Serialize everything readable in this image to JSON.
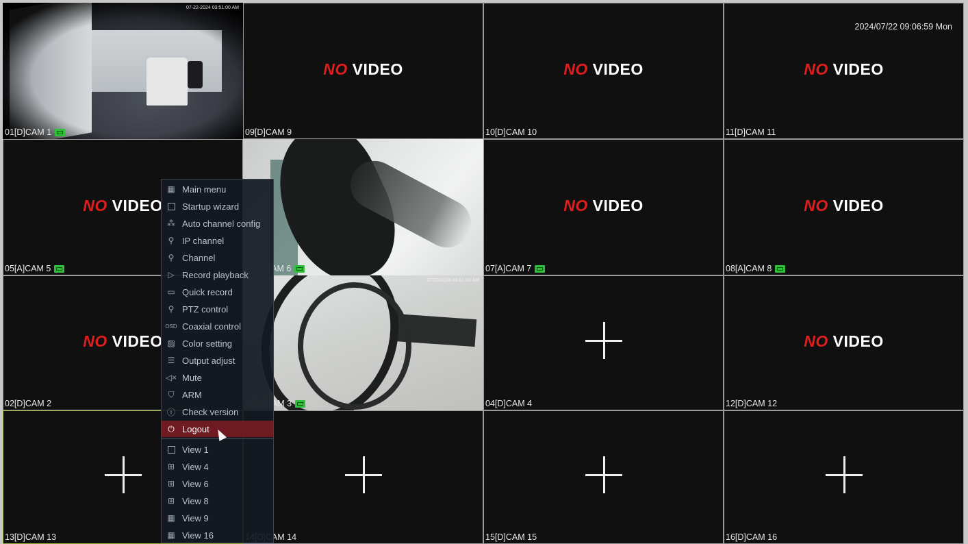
{
  "datetime": "2024/07/22 09:06:59 Mon",
  "osd_timestamp": "07-22-2024 03:51:00 AM",
  "osd_timestamp_cam3": "07/22/2024 03:51:01 AM",
  "no_video": {
    "no": "NO",
    "video": "VIDEO"
  },
  "tiles": [
    {
      "label": "01[D]CAM 1",
      "kind": "camera",
      "recording": true
    },
    {
      "label": "09[D]CAM 9",
      "kind": "novideo",
      "recording": false
    },
    {
      "label": "10[D]CAM 10",
      "kind": "novideo",
      "recording": false
    },
    {
      "label": "11[D]CAM 11",
      "kind": "novideo",
      "recording": false
    },
    {
      "label": "05[A]CAM 5",
      "kind": "novideo",
      "recording": true
    },
    {
      "label": "06[A]CAM 6",
      "kind": "camera",
      "recording": true
    },
    {
      "label": "07[A]CAM 7",
      "kind": "novideo",
      "recording": true
    },
    {
      "label": "08[A]CAM 8",
      "kind": "novideo",
      "recording": true
    },
    {
      "label": "02[D]CAM 2",
      "kind": "novideo",
      "recording": false
    },
    {
      "label": "03[D]CAM 3",
      "kind": "camera",
      "recording": true
    },
    {
      "label": "04[D]CAM 4",
      "kind": "empty",
      "recording": false
    },
    {
      "label": "12[D]CAM 12",
      "kind": "novideo",
      "recording": false
    },
    {
      "label": "13[D]CAM 13",
      "kind": "empty",
      "recording": false
    },
    {
      "label": "14[D]CAM 14",
      "kind": "empty",
      "recording": false
    },
    {
      "label": "15[D]CAM 15",
      "kind": "empty",
      "recording": false
    },
    {
      "label": "16[D]CAM 16",
      "kind": "empty",
      "recording": false
    }
  ],
  "menu": {
    "items": [
      {
        "label": "Main menu",
        "icon": "grid-icon"
      },
      {
        "label": "Startup wizard",
        "icon": "document-icon"
      },
      {
        "label": "Auto channel config",
        "icon": "network-icon"
      },
      {
        "label": "IP channel",
        "icon": "ip-camera-icon"
      },
      {
        "label": "Channel",
        "icon": "camera-icon"
      },
      {
        "label": "Record playback",
        "icon": "play-icon"
      },
      {
        "label": "Quick record",
        "icon": "video-record-icon"
      },
      {
        "label": "PTZ control",
        "icon": "ptz-icon"
      },
      {
        "label": "Coaxial control",
        "icon": "osd-icon"
      },
      {
        "label": "Color setting",
        "icon": "image-icon"
      },
      {
        "label": "Output adjust",
        "icon": "sliders-icon"
      },
      {
        "label": "Mute",
        "icon": "mute-icon"
      },
      {
        "label": "ARM",
        "icon": "shield-icon"
      },
      {
        "label": "Check version",
        "icon": "info-icon"
      },
      {
        "label": "Logout",
        "icon": "power-icon",
        "active": true
      }
    ],
    "views": [
      {
        "label": "View 1",
        "icon": "view1-icon"
      },
      {
        "label": "View 4",
        "icon": "view4-icon"
      },
      {
        "label": "View 6",
        "icon": "view6-icon"
      },
      {
        "label": "View 8",
        "icon": "view8-icon"
      },
      {
        "label": "View 9",
        "icon": "view9-icon"
      },
      {
        "label": "View 16",
        "icon": "view16-icon"
      }
    ],
    "osd_icon_text": "OSD"
  }
}
